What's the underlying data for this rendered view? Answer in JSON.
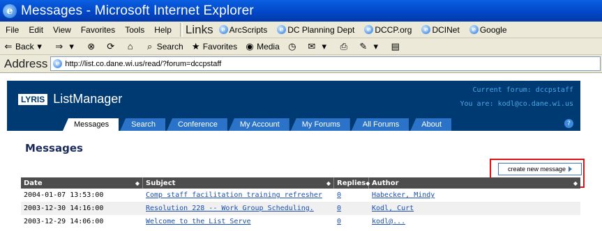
{
  "window": {
    "title": "Messages - Microsoft Internet Explorer"
  },
  "menu": [
    "File",
    "Edit",
    "View",
    "Favorites",
    "Tools",
    "Help"
  ],
  "links_bar": {
    "label": "Links",
    "items": [
      "ArcScripts",
      "DC Planning Dept",
      "DCCP.org",
      "DCINet",
      "Google"
    ]
  },
  "toolbar": {
    "back": "Back",
    "search": "Search",
    "favorites": "Favorites",
    "media": "Media"
  },
  "address": {
    "label": "Address",
    "url": "http://list.co.dane.wi.us/read/?forum=dccpstaff"
  },
  "app": {
    "badge": "LYRIS",
    "name": "ListManager",
    "current_forum": "Current forum: dccpstaff",
    "you_are": "You are: kodl@co.dane.wi.us"
  },
  "tabs": [
    "Messages",
    "Search",
    "Conference",
    "My Account",
    "My Forums",
    "All Forums",
    "About"
  ],
  "page": {
    "title": "Messages",
    "create_button": "create new message"
  },
  "table": {
    "headers": [
      "Date",
      "Subject",
      "Replies",
      "Author"
    ],
    "rows": [
      {
        "date": "2004-01-07 13:53:00",
        "subject": "Comp staff facilitation training refresher",
        "replies": "0",
        "author": "Habecker, Mindy"
      },
      {
        "date": "2003-12-30 14:16:00",
        "subject": "Resolution 228 -- Work Group Scheduling.",
        "replies": "0",
        "author": "Kodl, Curt"
      },
      {
        "date": "2003-12-29 14:06:00",
        "subject": "Welcome to the List Serve",
        "replies": "0",
        "author": "kodl@..."
      }
    ]
  }
}
